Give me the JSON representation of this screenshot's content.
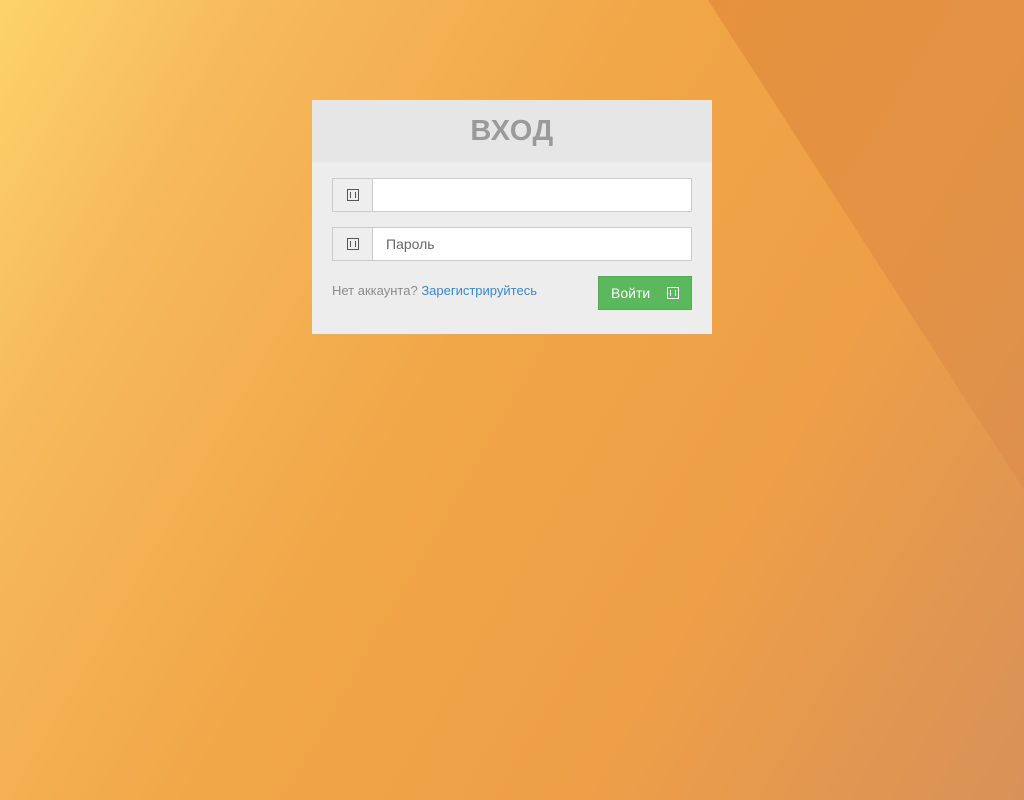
{
  "login": {
    "title": "ВХОД",
    "username": {
      "icon": "user-icon",
      "value": "",
      "placeholder": ""
    },
    "password": {
      "icon": "lock-icon",
      "value": "",
      "placeholder": "Пароль"
    },
    "no_account_text": "Нет аккаунта?",
    "register_link": "Зарегистрируйтесь",
    "submit_label": "Войти",
    "submit_icon": "log-in-icon"
  },
  "colors": {
    "button": "#5cb85c",
    "link": "#3a87c8",
    "title": "#9a9a9a"
  }
}
